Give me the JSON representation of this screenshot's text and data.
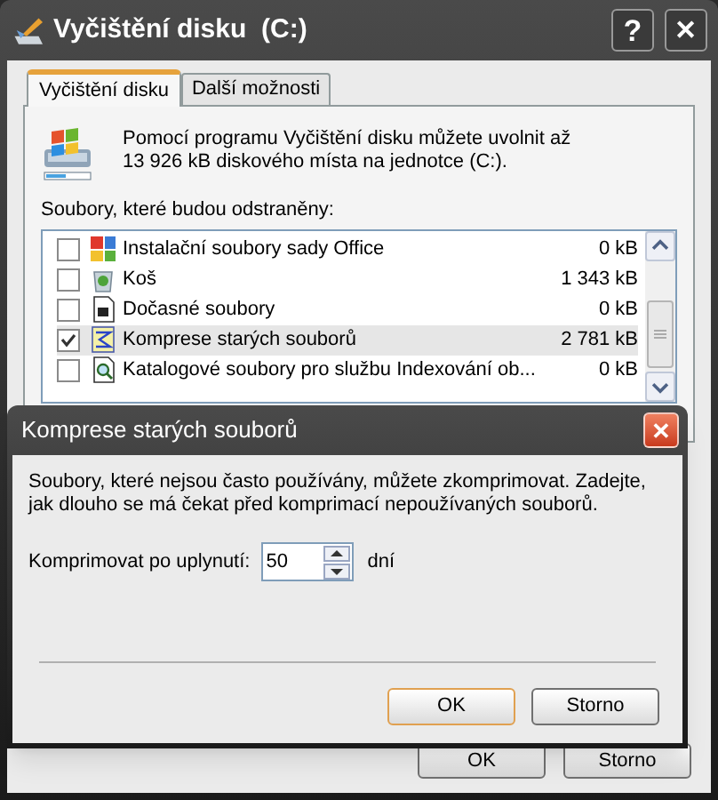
{
  "window": {
    "title": "Vyčištění disku  (C:)",
    "help_button": "?",
    "close_button": "✕"
  },
  "tabs": [
    {
      "label": "Vyčištění disku",
      "selected": true
    },
    {
      "label": "Další možnosti",
      "selected": false
    }
  ],
  "intro": "Pomocí programu Vyčištění disku můžete uvolnit až 13 926 kB diskového místa na jednotce  (C:).",
  "list_label": "Soubory, které budou odstraněny:",
  "files": [
    {
      "name": "Instalační soubory sady Office",
      "size": "0 kB",
      "checked": false,
      "selected": false
    },
    {
      "name": "Koš",
      "size": "1 343 kB",
      "checked": false,
      "selected": false
    },
    {
      "name": "Dočasné soubory",
      "size": "0 kB",
      "checked": false,
      "selected": false
    },
    {
      "name": "Komprese starých souborů",
      "size": "2 781 kB",
      "checked": true,
      "selected": true
    },
    {
      "name": "Katalogové soubory pro službu Indexování ob...",
      "size": "0 kB",
      "checked": false,
      "selected": false
    }
  ],
  "buttons": [
    "OK",
    "Storno"
  ],
  "dialog": {
    "title": "Komprese starých souborů",
    "close_button": "✕",
    "message": "Soubory, které nejsou často používány, můžete zkomprimovat. Zadejte, jak dlouho se má čekat před komprimací nepoužívaných souborů.",
    "field_label": "Komprimovat po uplynutí:",
    "value": "50",
    "unit": "dní",
    "buttons": [
      "OK",
      "Storno"
    ]
  }
}
